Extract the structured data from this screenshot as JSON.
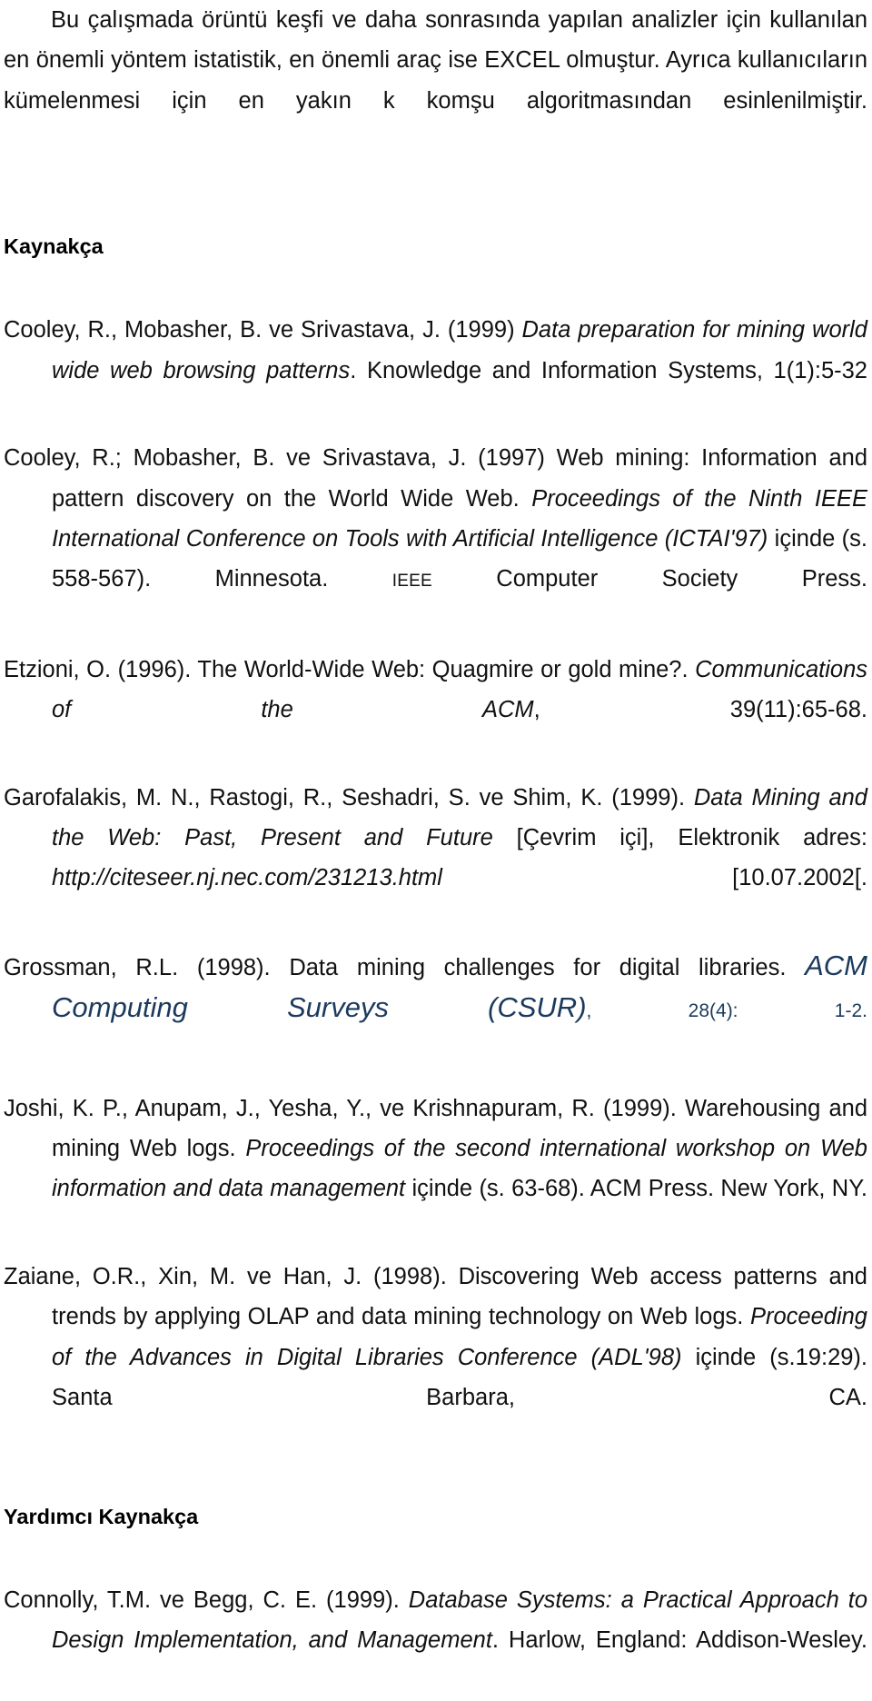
{
  "document": {
    "language": "tr",
    "intro_paragraph": "Bu çalışmada örüntü keşfi ve daha sonrasında yapılan analizler için kullanılan en önemli yöntem istatistik, en önemli araç ise EXCEL olmuştur. Ayrıca kullanıcıların kümelenmesi için en yakın k komşu algoritmasından esinlenilmiştir.",
    "bibliography_heading": "Kaynakça",
    "secondary_heading": "Yardımcı Kaynakça",
    "accent_color": "#1b3a5e",
    "text_color": "#111111"
  },
  "references": {
    "cooley1999": {
      "authors_year": "Cooley, R., Mobasher, B. ve Srivastava, J. (1999) ",
      "title_italic": "Data preparation for mining world wide web browsing patterns",
      "tail": ". Knowledge and Information Systems, 1(1):5-32"
    },
    "cooley1997": {
      "authors_year": "Cooley, R.; Mobasher, B. ve Srivastava, J. (1997) Web mining: Information and pattern discovery on the World Wide Web. ",
      "title_italic": "Proceedings of the Ninth IEEE International Conference on Tools with Artificial Intelligence (ICTAI'97)",
      "mid": " içinde (s. 558-567). Minnesota. ",
      "smallcaps": "IEEE",
      "tail": " Computer Society Press."
    },
    "etzioni1996": {
      "authors_year": "Etzioni, O. (1996). The World-Wide Web: Quagmire or gold mine?. ",
      "title_italic": "Communications of the ACM",
      "tail": ", 39(11):65-68."
    },
    "garofalakis1999": {
      "authors_year": "Garofalakis, M. N., Rastogi, R., Seshadri, S. ve Shim, K. (1999). ",
      "title_italic": "Data Mining and the Web: Past, Present and Future",
      "mid": " [Çevrim içi], Elektronik adres: ",
      "url_italic": "http://citeseer.nj.nec.com/231213.html",
      "tail": "  [10.07.2002[."
    },
    "grossman1998": {
      "authors_year": "Grossman, R.L. (1998). Data mining challenges for digital libraries. ",
      "journal_accent": "ACM Computing Surveys (CSUR)",
      "volume_accent": ", 28(4): 1-2."
    },
    "joshi1999": {
      "authors_year": "Joshi, K. P., Anupam, J., Yesha, Y., ve Krishnapuram, R. (1999). Warehousing and mining Web logs. ",
      "title_italic": "Proceedings of the second international workshop on Web information and data management",
      "tail": " içinde (s. 63-68). ACM Press. New York, NY."
    },
    "zaiane1998": {
      "authors_year": "Zaiane, O.R., Xin, M. ve Han, J. (1998). Discovering Web access patterns and trends by applying OLAP and data mining technology on Web logs. ",
      "title_italic": "Proceeding of the Advances in Digital Libraries Conference (ADL'98)",
      "tail": " içinde (s.19:29). Santa Barbara, CA."
    },
    "connolly1999": {
      "authors_year": "Connolly, T.M. ve Begg, C. E. (1999). ",
      "title_italic": "Database Systems: a Practical Approach to Design Implementation, and Management",
      "tail": ". Harlow, England: Addison-Wesley."
    }
  }
}
